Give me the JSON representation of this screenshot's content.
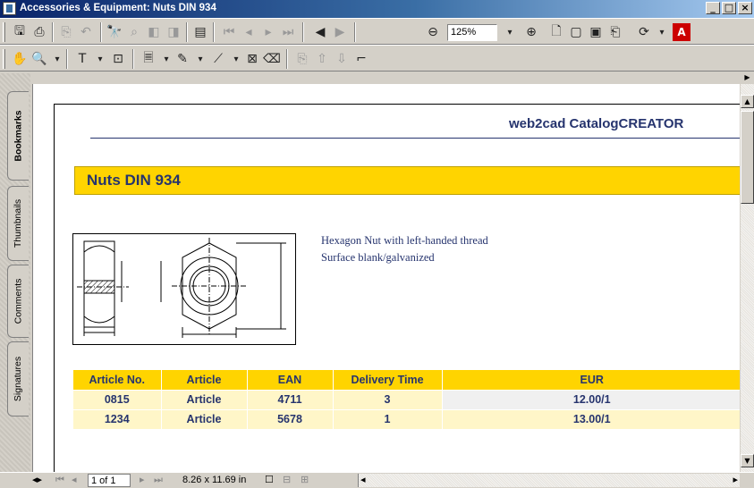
{
  "window": {
    "title": "Accessories & Equipment: Nuts DIN 934",
    "controls": {
      "minimize": "_",
      "maximize": "□",
      "close": "×"
    }
  },
  "toolbar1": {
    "zoom_value": "125%",
    "icons": [
      "save-icon",
      "print-icon",
      "copy-icon",
      "undo-icon",
      "find-icon",
      "search-icon",
      "prev-view-icon",
      "next-view-icon",
      "fit-window-icon",
      "first-page-icon",
      "prev-page-icon",
      "next-page-icon",
      "last-page-icon",
      "go-back-icon",
      "go-forward-icon",
      "zoom-out-icon",
      "zoom-in-icon",
      "actual-size-icon",
      "fit-page-icon",
      "fit-width-icon",
      "reflow-icon",
      "rotate-icon",
      "adobe-icon"
    ]
  },
  "toolbar2": {
    "icons": [
      "hand-tool-icon",
      "zoom-tool-icon",
      "text-select-icon",
      "snapshot-icon",
      "note-icon",
      "pencil-icon",
      "line-icon",
      "stamp-icon",
      "eraser-icon",
      "attach-icon",
      "up-icon",
      "down-icon",
      "crop-icon"
    ]
  },
  "nav_tabs": [
    "Bookmarks",
    "Thumbnails",
    "Comments",
    "Signatures"
  ],
  "document": {
    "brand": "web2cad CatalogCREATOR",
    "heading": "Nuts DIN 934",
    "description": [
      "Hexagon Nut with left-handed thread",
      "Surface blank/galvanized"
    ],
    "table": {
      "headers": [
        "Article No.",
        "Article",
        "EAN",
        "Delivery Time",
        "EUR"
      ],
      "rows": [
        [
          "0815",
          "Article",
          "4711",
          "3",
          "12.00/1"
        ],
        [
          "1234",
          "Article",
          "5678",
          "1",
          "13.00/1"
        ]
      ]
    }
  },
  "statusbar": {
    "page_indicator": "1 of 1",
    "page_size": "8.26 x 11.69 in"
  },
  "colors": {
    "accent_yellow": "#ffd400",
    "text_navy": "#26346e",
    "titlebar": "#0a246a"
  }
}
